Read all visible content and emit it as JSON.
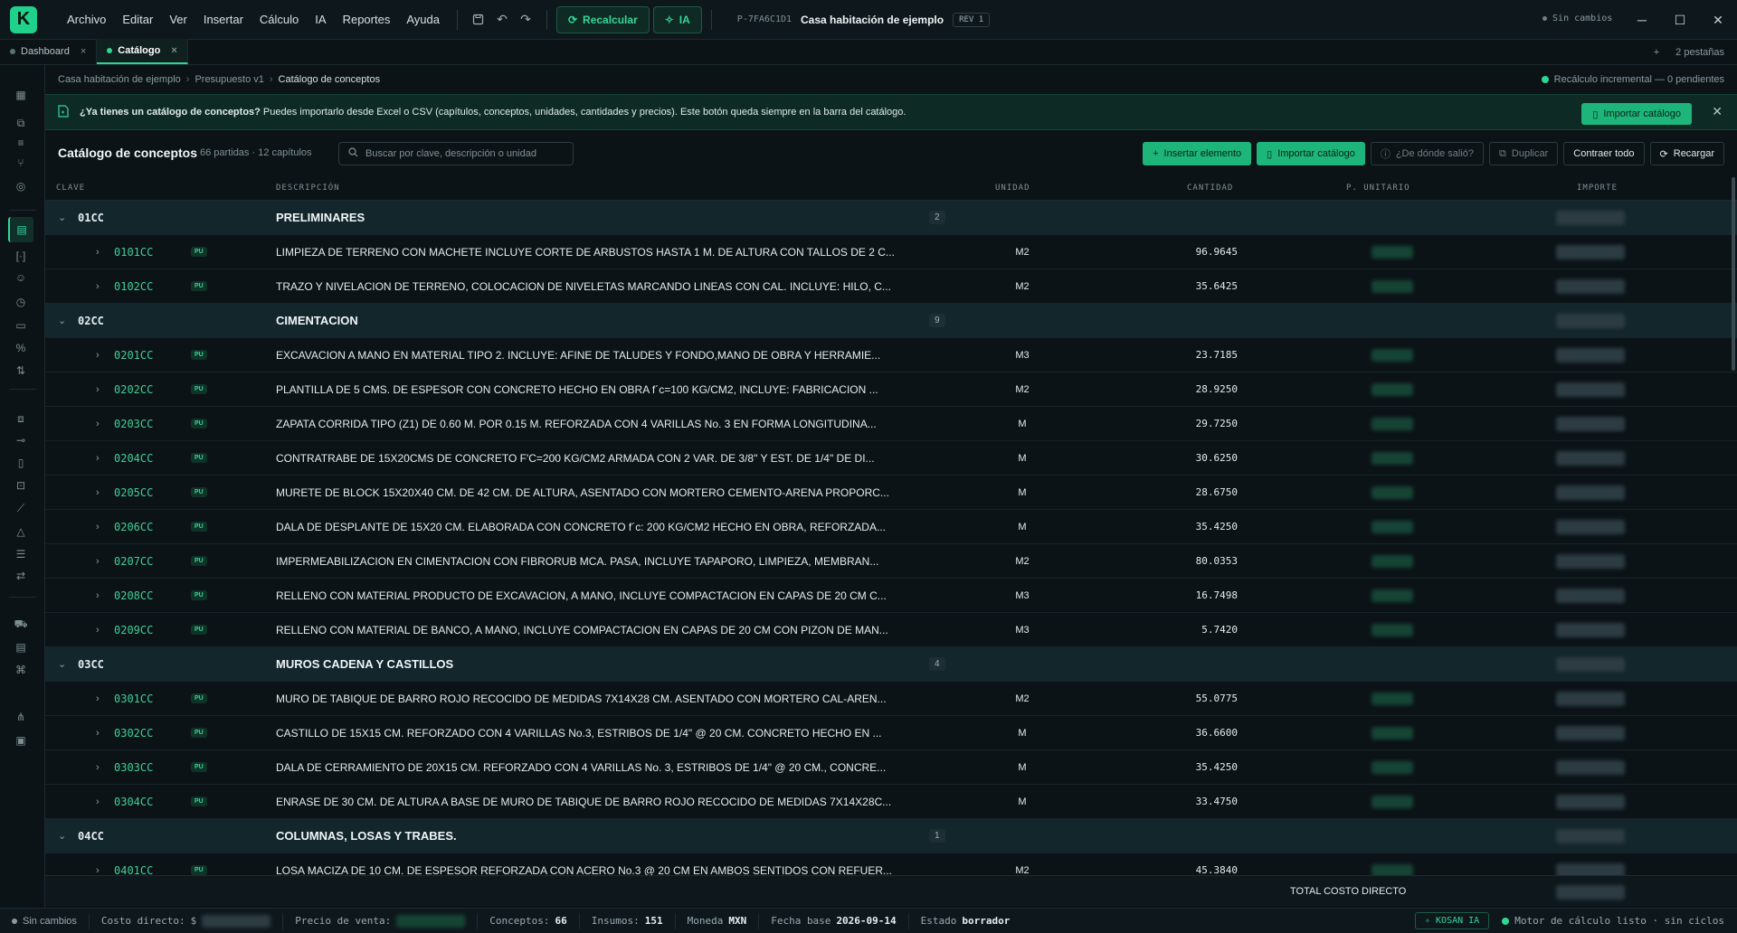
{
  "menu": [
    "Archivo",
    "Editar",
    "Ver",
    "Insertar",
    "Cálculo",
    "IA",
    "Reportes",
    "Ayuda"
  ],
  "toolbar": {
    "recalc_label": "Recalcular",
    "ia_label": "IA"
  },
  "document": {
    "id": "P-7FA6C1D1",
    "title": "Casa habitación de ejemplo",
    "rev": "REV 1",
    "save_state": "Sin cambios"
  },
  "tabs": [
    {
      "label": "Dashboard",
      "active": false
    },
    {
      "label": "Catálogo",
      "active": true
    }
  ],
  "tabs_count": "2 pestañas",
  "tabs_add": "+",
  "breadcrumb": [
    "Casa habitación de ejemplo",
    "Presupuesto v1",
    "Catálogo de conceptos"
  ],
  "calc_status": "Recálculo incremental — 0 pendientes",
  "banner": {
    "bold": "¿Ya tienes un catálogo de conceptos?",
    "text": " Puedes importarlo desde Excel o CSV (capítulos, conceptos, unidades, cantidades y precios). Este botón queda siempre en la barra del catálogo.",
    "button": "Importar catálogo"
  },
  "catalog": {
    "title": "Catálogo de conceptos",
    "meta": "66 partidas · 12 capítulos",
    "search_placeholder": "Buscar por clave, descripción o unidad"
  },
  "actions": [
    "Insertar elemento",
    "Importar catálogo",
    "¿De dónde salió?",
    "Duplicar",
    "Contraer todo",
    "Recargar"
  ],
  "columns": [
    "CLAVE",
    "DESCRIPCIÓN",
    "UNIDAD",
    "CANTIDAD",
    "P. UNITARIO",
    "IMPORTE"
  ],
  "rows": [
    {
      "type": "group",
      "key": "01CC",
      "desc": "PRELIMINARES",
      "count": "2"
    },
    {
      "type": "item",
      "key": "0101CC",
      "tag": "PU",
      "desc": "LIMPIEZA DE TERRENO CON MACHETE INCLUYE CORTE DE ARBUSTOS HASTA 1 M. DE ALTURA CON TALLOS DE 2 C...",
      "unit": "M2",
      "qty": "96.9645"
    },
    {
      "type": "item",
      "key": "0102CC",
      "tag": "PU",
      "desc": "TRAZO Y NIVELACION DE TERRENO, COLOCACION DE NIVELETAS MARCANDO LINEAS CON CAL. INCLUYE: HILO, C...",
      "unit": "M2",
      "qty": "35.6425"
    },
    {
      "type": "group",
      "key": "02CC",
      "desc": "CIMENTACION",
      "count": "9"
    },
    {
      "type": "item",
      "key": "0201CC",
      "tag": "PU",
      "desc": "EXCAVACION A MANO EN MATERIAL TIPO 2. INCLUYE: AFINE DE TALUDES Y FONDO,MANO DE OBRA Y HERRAMIE...",
      "unit": "M3",
      "qty": "23.7185"
    },
    {
      "type": "item",
      "key": "0202CC",
      "tag": "PU",
      "desc": "PLANTILLA DE 5 CMS. DE ESPESOR CON CONCRETO HECHO EN OBRA f´c=100 KG/CM2, INCLUYE: FABRICACION ...",
      "unit": "M2",
      "qty": "28.9250"
    },
    {
      "type": "item",
      "key": "0203CC",
      "tag": "PU",
      "desc": "ZAPATA CORRIDA TIPO (Z1) DE 0.60 M. POR 0.15 M. REFORZADA CON 4 VARILLAS No. 3 EN FORMA LONGITUDINA...",
      "unit": "M",
      "qty": "29.7250"
    },
    {
      "type": "item",
      "key": "0204CC",
      "tag": "PU",
      "desc": "CONTRATRABE DE 15X20CMS DE CONCRETO F'C=200 KG/CM2 ARMADA CON 2 VAR. DE 3/8\" Y EST. DE 1/4\" DE DI...",
      "unit": "M",
      "qty": "30.6250"
    },
    {
      "type": "item",
      "key": "0205CC",
      "tag": "PU",
      "desc": "MURETE DE BLOCK 15X20X40 CM. DE 42 CM. DE ALTURA, ASENTADO CON MORTERO CEMENTO-ARENA PROPORC...",
      "unit": "M",
      "qty": "28.6750"
    },
    {
      "type": "item",
      "key": "0206CC",
      "tag": "PU",
      "desc": "DALA DE DESPLANTE DE 15X20 CM. ELABORADA CON CONCRETO f´c: 200 KG/CM2 HECHO EN OBRA, REFORZADA...",
      "unit": "M",
      "qty": "35.4250"
    },
    {
      "type": "item",
      "key": "0207CC",
      "tag": "PU",
      "desc": "IMPERMEABILIZACION EN CIMENTACION CON FIBRORUB MCA. PASA, INCLUYE TAPAPORO, LIMPIEZA, MEMBRAN...",
      "unit": "M2",
      "qty": "80.0353"
    },
    {
      "type": "item",
      "key": "0208CC",
      "tag": "PU",
      "desc": "RELLENO CON MATERIAL PRODUCTO DE EXCAVACION, A MANO, INCLUYE COMPACTACION EN CAPAS DE 20 CM C...",
      "unit": "M3",
      "qty": "16.7498"
    },
    {
      "type": "item",
      "key": "0209CC",
      "tag": "PU",
      "desc": "RELLENO CON MATERIAL DE BANCO, A MANO, INCLUYE COMPACTACION EN CAPAS DE 20 CM CON PIZON DE MAN...",
      "unit": "M3",
      "qty": "5.7420"
    },
    {
      "type": "group",
      "key": "03CC",
      "desc": "MUROS CADENA Y CASTILLOS",
      "count": "4"
    },
    {
      "type": "item",
      "key": "0301CC",
      "tag": "PU",
      "desc": "MURO DE TABIQUE DE BARRO ROJO RECOCIDO DE MEDIDAS 7X14X28 CM. ASENTADO CON MORTERO CAL-AREN...",
      "unit": "M2",
      "qty": "55.0775"
    },
    {
      "type": "item",
      "key": "0302CC",
      "tag": "PU",
      "desc": "CASTILLO DE 15X15 CM. REFORZADO CON 4 VARILLAS No.3, ESTRIBOS DE 1/4\" @ 20 CM. CONCRETO HECHO EN ...",
      "unit": "M",
      "qty": "36.6600"
    },
    {
      "type": "item",
      "key": "0303CC",
      "tag": "PU",
      "desc": "DALA DE CERRAMIENTO DE 20X15 CM. REFORZADO CON 4 VARILLAS No. 3, ESTRIBOS DE 1/4\" @ 20 CM., CONCRE...",
      "unit": "M",
      "qty": "35.4250"
    },
    {
      "type": "item",
      "key": "0304CC",
      "tag": "PU",
      "desc": "ENRASE DE 30 CM. DE ALTURA A BASE DE MURO DE TABIQUE DE BARRO ROJO RECOCIDO DE MEDIDAS 7X14X28C...",
      "unit": "M",
      "qty": "33.4750"
    },
    {
      "type": "group",
      "key": "04CC",
      "desc": "COLUMNAS, LOSAS Y TRABES.",
      "count": "1"
    },
    {
      "type": "item",
      "key": "0401CC",
      "tag": "PU",
      "desc": "LOSA MACIZA DE 10 CM. DE ESPESOR REFORZADA CON ACERO No.3 @ 20 CM EN AMBOS SENTIDOS CON REFUER...",
      "unit": "M2",
      "qty": "45.3840"
    }
  ],
  "total_label": "TOTAL COSTO DIRECTO",
  "status": {
    "state": "Sin cambios",
    "costo_label": "Costo directo:",
    "costo_prefix": "$",
    "venta_label": "Precio de venta:",
    "conceptos_label": "Conceptos:",
    "conceptos": "66",
    "insumos_label": "Insumos:",
    "insumos": "151",
    "moneda_label": "Moneda",
    "moneda": "MXN",
    "fecha_label": "Fecha base",
    "fecha": "2026-09-14",
    "estado_label": "Estado",
    "estado": "borrador",
    "kosan": "KOSAN IA",
    "engine": "Motor de cálculo listo · sin ciclos"
  },
  "colors": {
    "accent": "#1eb57a",
    "accent_text": "#35d69a",
    "bg": "#0b1317",
    "group_bg": "#13262c"
  }
}
